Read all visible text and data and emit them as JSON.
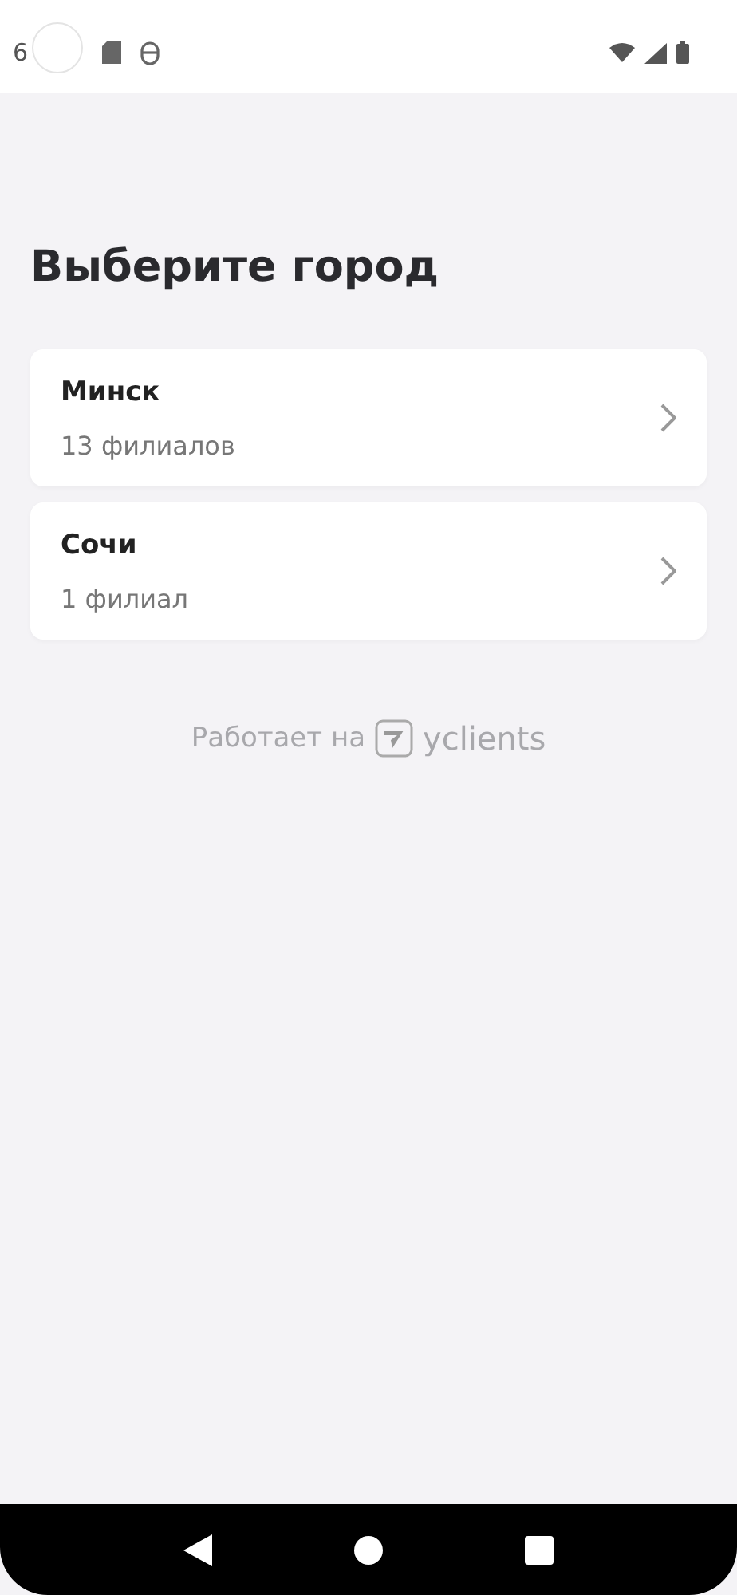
{
  "status_bar": {
    "time": "6"
  },
  "title": "Выберите город",
  "cities": [
    {
      "name": "Минск",
      "branches": "13 филиалов"
    },
    {
      "name": "Сочи",
      "branches": "1 филиал"
    }
  ],
  "footer": {
    "text": "Работает на",
    "brand": "yclients"
  }
}
